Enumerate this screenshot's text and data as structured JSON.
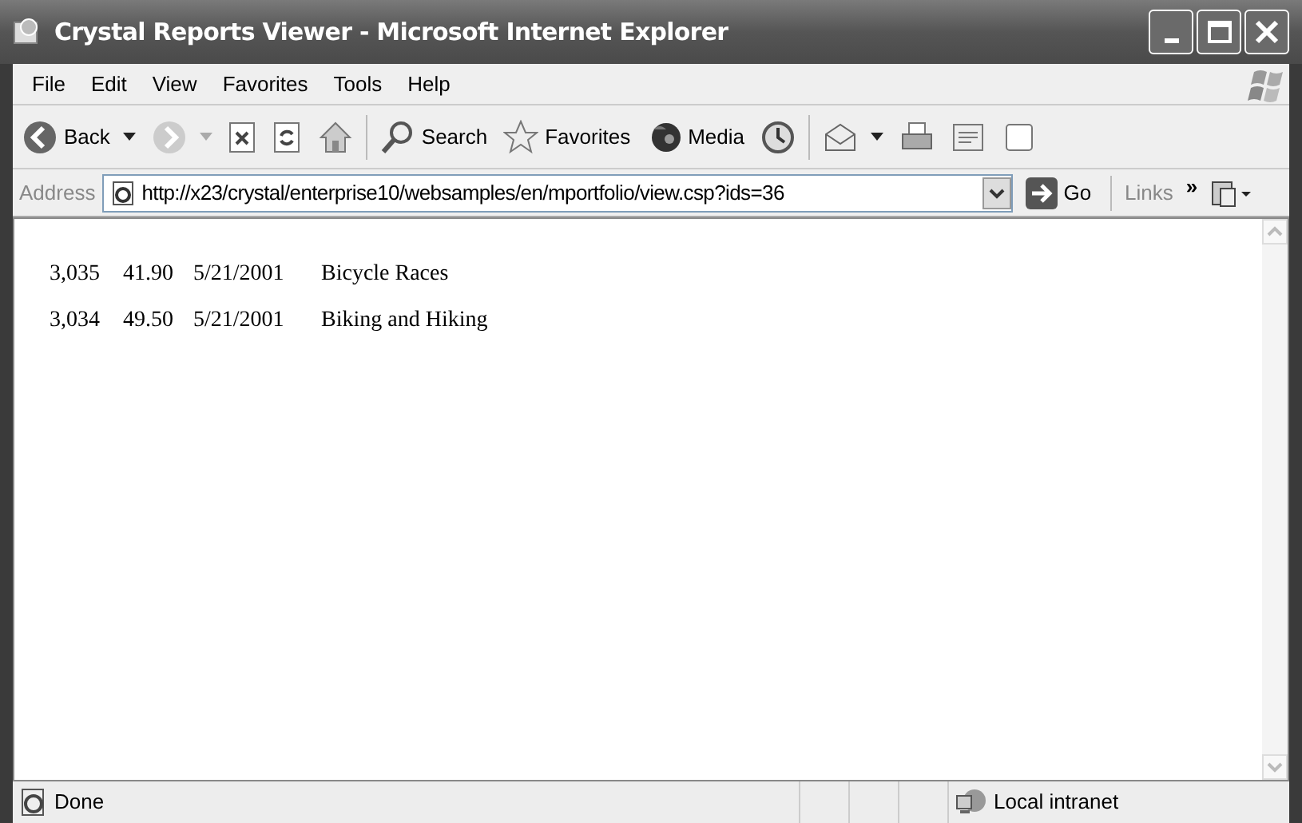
{
  "window": {
    "title": "Crystal Reports Viewer - Microsoft Internet Explorer"
  },
  "menu": [
    "File",
    "Edit",
    "View",
    "Favorites",
    "Tools",
    "Help"
  ],
  "toolbar": [
    {
      "kind": "back",
      "label": "Back",
      "dropdown": true
    },
    {
      "kind": "forward",
      "dropdown": true
    },
    {
      "kind": "stop"
    },
    {
      "kind": "refresh"
    },
    {
      "kind": "home"
    },
    {
      "kind": "separator"
    },
    {
      "kind": "search",
      "label": "Search"
    },
    {
      "kind": "favorites",
      "label": "Favorites"
    },
    {
      "kind": "media",
      "label": "Media"
    },
    {
      "kind": "history"
    },
    {
      "kind": "separator"
    },
    {
      "kind": "mail",
      "dropdown": true
    },
    {
      "kind": "print"
    },
    {
      "kind": "edit"
    },
    {
      "kind": "discuss"
    }
  ],
  "address": {
    "label": "Address",
    "url": "http://x23/crystal/enterprise10/websamples/en/mportfolio/view.csp?ids=36",
    "go": "Go",
    "links": "Links",
    "chevron": "»"
  },
  "rows": [
    {
      "cells": [
        "3,035",
        "41.90",
        "5/21/2001",
        "Bicycle Races"
      ]
    },
    {
      "cells": [
        "3,034",
        "49.50",
        "5/21/2001",
        "Biking and Hiking"
      ]
    }
  ],
  "status_bar": {
    "text": "Done",
    "zone": "Local intranet"
  }
}
